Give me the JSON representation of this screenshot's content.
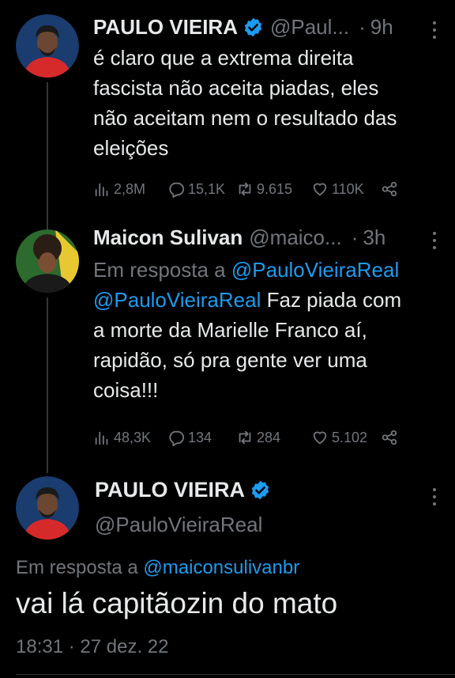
{
  "colors": {
    "background": "#000000",
    "text": "#e7e9ea",
    "muted": "#71767b",
    "link": "#1d9bf0",
    "verified": "#1d9bf0"
  },
  "tweet1": {
    "author_name": "PAULO VIEIRA",
    "verified_icon": "verified-badge-icon",
    "handle": "@Paul...",
    "dot": "·",
    "time": "9h",
    "text_lines": [
      "é claro que a extrema direita",
      "fascista não aceita piadas, eles",
      "não aceitam nem o resultado das",
      "eleições"
    ],
    "stats": {
      "views": "2,8M",
      "replies": "15,1K",
      "retweets": "9.615",
      "likes": "110K"
    }
  },
  "tweet2": {
    "author_name": "Maicon Sulivan",
    "handle": "@maico...",
    "dot": "·",
    "time": "3h",
    "reply_prefix": "Em resposta a",
    "reply_mention": "@PauloVieiraReal",
    "mention": "@PauloVieiraReal",
    "text_lines": [
      " Faz piada com",
      "a morte da Marielle Franco aí,",
      "rapidão, só pra gente ver uma",
      "coisa!!!"
    ],
    "stats": {
      "views": "48,3K",
      "replies": "134",
      "retweets": "284",
      "likes": "5.102"
    }
  },
  "focus_tweet": {
    "author_name": "PAULO VIEIRA",
    "handle": "@PauloVieiraReal",
    "reply_prefix": "Em resposta a",
    "reply_mention": "@maiconsulivanbr",
    "text": "vai lá capitãozin do mato",
    "timestamp": "18:31 · 27 dez. 22"
  }
}
